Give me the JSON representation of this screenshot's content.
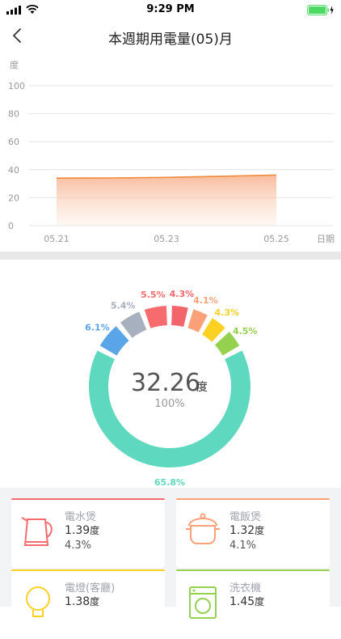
{
  "status_bar": {
    "time": "9:29 PM"
  },
  "header": {
    "title": "本週期用電量(05)月",
    "back_icon": "chevron-left-icon"
  },
  "chart_data": {
    "type": "area",
    "ylabel": "度",
    "xlabel": "日期",
    "ylim": [
      0,
      100
    ],
    "y_ticks": [
      "0",
      "20",
      "40",
      "60",
      "80",
      "100"
    ],
    "x_ticks": [
      "05.21",
      "05.23",
      "05.25"
    ],
    "x": [
      "05.21",
      "05.22",
      "05.23",
      "05.24",
      "05.25"
    ],
    "series": [
      {
        "values": [
          34,
          34.1,
          34.5,
          35.3,
          36.2
        ]
      }
    ],
    "grid": true,
    "color": "#f08a3c"
  },
  "donut": {
    "total_value": "32.26",
    "total_unit": "度",
    "total_percent": "100%",
    "segments": [
      {
        "label": "65.8%",
        "value": 65.8,
        "color": "#5fd8c0"
      },
      {
        "label": "6.1%",
        "value": 6.1,
        "color": "#5aa4e8"
      },
      {
        "label": "5.4%",
        "value": 5.4,
        "color": "#a7b0be"
      },
      {
        "label": "5.5%",
        "value": 5.5,
        "color": "#f56b6e"
      },
      {
        "label": "4.3%",
        "value": 4.3,
        "color": "#f2656a"
      },
      {
        "label": "4.1%",
        "value": 4.1,
        "color": "#fba078"
      },
      {
        "label": "4.3%",
        "value": 4.3,
        "color": "#fdd024"
      },
      {
        "label": "4.5%",
        "value": 4.5,
        "color": "#93d14e"
      }
    ]
  },
  "cards": [
    {
      "name": "電水煲",
      "value": "1.39",
      "unit": "度",
      "percent": "4.3%",
      "color": "#f56b6e",
      "icon": "kettle-icon"
    },
    {
      "name": "電飯煲",
      "value": "1.32",
      "unit": "度",
      "percent": "4.1%",
      "color": "#fba078",
      "icon": "rice-cooker-icon"
    },
    {
      "name": "電燈(客廳)",
      "value": "1.38",
      "unit": "度",
      "percent": "",
      "color": "#fdd024",
      "icon": "light-bulb-icon"
    },
    {
      "name": "洗衣機",
      "value": "1.45",
      "unit": "度",
      "percent": "",
      "color": "#93d14e",
      "icon": "washing-machine-icon"
    }
  ]
}
